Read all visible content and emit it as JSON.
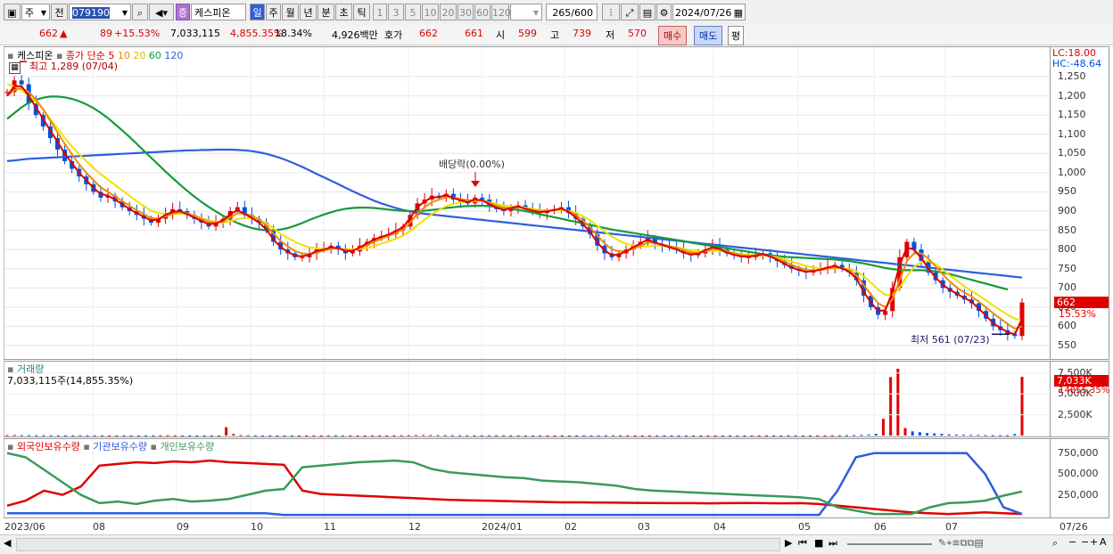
{
  "toolbar": {
    "period_type": "주",
    "prev_label": "전",
    "code": "079190",
    "stock_badge": "증",
    "stock_name": "케스피온",
    "periods": [
      "일",
      "주",
      "월",
      "년",
      "분",
      "초",
      "틱"
    ],
    "intervals": [
      "1",
      "3",
      "5",
      "10",
      "20",
      "30",
      "60",
      "120"
    ],
    "count": "265",
    "count_total": "/600",
    "date": "2024/07/26"
  },
  "quote": {
    "price": "662",
    "arrow": "▲",
    "change": "89",
    "change_pct": "+15.53%",
    "volume": "7,033,115",
    "volume_pct": "4,855.35%",
    "turnover": "18.34%",
    "amount": "4,926백만",
    "bid_label": "호가",
    "ask": "662",
    "bid": "661",
    "open_label": "시",
    "open": "599",
    "high_label": "고",
    "high": "739",
    "low_label": "저",
    "low": "570",
    "buy_label": "매수",
    "sell_label": "매도",
    "eval_label": "평"
  },
  "colors": {
    "up": "#e00000",
    "down": "#0050e0",
    "ma5": "#dd0000",
    "ma10": "#f08c00",
    "ma20": "#f0e000",
    "ma60": "#159a3c",
    "ma120": "#2f5de0",
    "foreign": "#e00000",
    "inst": "#2f5de0",
    "retail": "#3a9a5a"
  },
  "price_panel": {
    "name": "케스피온",
    "legend_label": "종가 단순",
    "ma_periods": [
      "5",
      "10",
      "20",
      "60",
      "120"
    ],
    "high_note": "최고 1,289 (07/04)",
    "low_note": "최저 561 (07/23)",
    "event_note": "배당락(0.00%)",
    "lc": "LC:18.00",
    "hc": "HC:-48.64",
    "current_price": "662",
    "current_pct": "15.53%"
  },
  "volume_panel": {
    "name": "거래량",
    "note": "7,033,115주(14,855.35%)",
    "current": "7,033K",
    "current_pct": "14855.35%"
  },
  "holding_panel": {
    "series_names": [
      "외국인보유수량",
      "기관보유수량",
      "개인보유수량"
    ]
  },
  "x_labels": [
    "2023/06",
    "08",
    "09",
    "10",
    "11",
    "12",
    "2024/01",
    "02",
    "03",
    "04",
    "05",
    "06",
    "07",
    "07/26"
  ],
  "chart_data": [
    {
      "type": "candlestick",
      "title": "케스피온",
      "ylim": [
        550,
        1280
      ],
      "y_ticks": [
        550,
        600,
        650,
        700,
        750,
        800,
        850,
        900,
        950,
        1000,
        1050,
        1100,
        1150,
        1200,
        1250
      ],
      "x_labels": [
        "2023/06",
        "08",
        "09",
        "10",
        "11",
        "12",
        "2024/01",
        "02",
        "03",
        "04",
        "05",
        "06",
        "07"
      ],
      "close": [
        1210,
        1240,
        1230,
        1180,
        1150,
        1120,
        1090,
        1060,
        1030,
        1010,
        990,
        970,
        950,
        935,
        940,
        925,
        910,
        900,
        890,
        880,
        870,
        880,
        895,
        905,
        900,
        890,
        880,
        870,
        860,
        870,
        880,
        900,
        910,
        890,
        880,
        870,
        850,
        820,
        800,
        790,
        780,
        780,
        790,
        800,
        800,
        810,
        800,
        790,
        795,
        810,
        820,
        830,
        835,
        840,
        850,
        860,
        890,
        920,
        930,
        940,
        935,
        945,
        930,
        925,
        920,
        935,
        930,
        915,
        905,
        900,
        910,
        915,
        905,
        900,
        895,
        900,
        905,
        910,
        895,
        880,
        860,
        840,
        810,
        790,
        780,
        790,
        800,
        810,
        820,
        830,
        815,
        810,
        805,
        800,
        790,
        785,
        790,
        800,
        810,
        800,
        790,
        785,
        780,
        780,
        785,
        790,
        780,
        770,
        760,
        750,
        745,
        740,
        745,
        750,
        755,
        760,
        750,
        740,
        720,
        680,
        650,
        630,
        640,
        700,
        780,
        820,
        800,
        770,
        740,
        720,
        700,
        690,
        680,
        670,
        660,
        640,
        620,
        600,
        590,
        580,
        575,
        662
      ],
      "ma5": [
        1200,
        1225,
        1225,
        1200,
        1170,
        1140,
        1110,
        1080,
        1050,
        1025,
        1000,
        980,
        960,
        945,
        940,
        930,
        918,
        905,
        895,
        885,
        876,
        878,
        890,
        898,
        900,
        892,
        883,
        874,
        866,
        868,
        876,
        892,
        902,
        893,
        882,
        870,
        852,
        826,
        806,
        794,
        784,
        782,
        787,
        796,
        800,
        806,
        803,
        796,
        796,
        806,
        816,
        826,
        833,
        839,
        848,
        858,
        882,
        910,
        925,
        936,
        936,
        942,
        934,
        928,
        923,
        930,
        928,
        918,
        909,
        903,
        908,
        912,
        906,
        901,
        897,
        899,
        903,
        907,
        898,
        884,
        866,
        846,
        818,
        798,
        785,
        787,
        796,
        806,
        816,
        826,
        818,
        812,
        806,
        800,
        792,
        787,
        789,
        798,
        806,
        801,
        792,
        786,
        782,
        781,
        784,
        788,
        782,
        773,
        763,
        753,
        747,
        742,
        744,
        748,
        753,
        757,
        751,
        742,
        724,
        690,
        662,
        640,
        642,
        690,
        760,
        805,
        800,
        778,
        750,
        727,
        708,
        695,
        684,
        674,
        664,
        646,
        628,
        608,
        596,
        585,
        579,
        620
      ],
      "ma10": [
        1200,
        1215,
        1220,
        1210,
        1190,
        1165,
        1135,
        1105,
        1075,
        1048,
        1022,
        1000,
        980,
        962,
        950,
        938,
        926,
        914,
        902,
        892,
        882,
        880,
        886,
        893,
        897,
        895,
        888,
        880,
        872,
        870,
        872,
        884,
        894,
        894,
        888,
        878,
        862,
        842,
        822,
        808,
        796,
        790,
        788,
        792,
        797,
        802,
        803,
        800,
        798,
        803,
        811,
        820,
        828,
        835,
        843,
        852,
        870,
        893,
        910,
        923,
        930,
        936,
        935,
        932,
        928,
        929,
        928,
        922,
        914,
        908,
        908,
        910,
        907,
        903,
        900,
        900,
        902,
        905,
        900,
        890,
        876,
        858,
        836,
        816,
        801,
        795,
        796,
        802,
        810,
        818,
        817,
        814,
        809,
        805,
        798,
        792,
        791,
        796,
        802,
        801,
        796,
        790,
        786,
        784,
        784,
        786,
        783,
        777,
        769,
        760,
        753,
        747,
        745,
        746,
        750,
        753,
        752,
        746,
        733,
        708,
        683,
        660,
        650,
        670,
        720,
        770,
        790,
        790,
        776,
        756,
        735,
        716,
        700,
        688,
        678,
        664,
        650,
        634,
        620,
        606,
        594,
        600
      ],
      "ma20": [
        1230,
        1225,
        1215,
        1200,
        1185,
        1165,
        1140,
        1115,
        1090,
        1068,
        1048,
        1030,
        1012,
        996,
        982,
        968,
        954,
        940,
        926,
        913,
        901,
        895,
        892,
        893,
        893,
        892,
        888,
        882,
        876,
        872,
        870,
        874,
        879,
        882,
        882,
        878,
        868,
        855,
        841,
        830,
        820,
        812,
        806,
        803,
        802,
        802,
        802,
        801,
        800,
        801,
        804,
        809,
        815,
        821,
        828,
        836,
        848,
        863,
        878,
        892,
        903,
        913,
        919,
        923,
        925,
        926,
        926,
        923,
        919,
        914,
        912,
        911,
        909,
        906,
        903,
        902,
        902,
        903,
        901,
        896,
        887,
        876,
        862,
        847,
        834,
        823,
        815,
        810,
        808,
        808,
        810,
        810,
        808,
        806,
        802,
        798,
        796,
        796,
        797,
        796,
        794,
        791,
        788,
        786,
        785,
        785,
        783,
        780,
        775,
        769,
        763,
        757,
        753,
        751,
        751,
        752,
        752,
        749,
        743,
        730,
        714,
        696,
        682,
        682,
        702,
        730,
        755,
        768,
        770,
        762,
        748,
        732,
        718,
        704,
        692,
        680,
        668,
        654,
        642,
        630,
        620,
        615
      ],
      "ma60": [
        1140,
        1155,
        1170,
        1182,
        1190,
        1195,
        1198,
        1198,
        1196,
        1192,
        1186,
        1178,
        1168,
        1156,
        1142,
        1126,
        1110,
        1093,
        1075,
        1057,
        1039,
        1021,
        1003,
        986,
        969,
        953,
        938,
        924,
        911,
        899,
        888,
        878,
        869,
        862,
        856,
        852,
        850,
        850,
        852,
        856,
        862,
        869,
        877,
        884,
        891,
        897,
        902,
        906,
        908,
        909,
        909,
        908,
        906,
        904,
        902,
        901,
        900,
        900,
        901,
        903,
        905,
        908,
        910,
        912,
        913,
        914,
        914,
        913,
        911,
        909,
        906,
        903,
        900,
        896,
        892,
        888,
        884,
        880,
        876,
        872,
        868,
        864,
        860,
        856,
        852,
        849,
        846,
        843,
        840,
        837,
        834,
        831,
        828,
        825,
        822,
        818,
        815,
        812,
        809,
        806,
        803,
        800,
        797,
        794,
        791,
        788,
        785,
        783,
        781,
        780,
        779,
        778,
        777,
        776,
        775,
        774,
        772,
        770,
        767,
        764,
        760,
        756,
        752,
        749,
        747,
        746,
        746,
        746,
        745,
        743,
        740,
        736,
        731,
        726,
        721,
        716,
        711,
        706,
        701,
        696
      ],
      "ma120": [
        1030,
        1032,
        1034,
        1036,
        1037,
        1038,
        1039,
        1040,
        1041,
        1042,
        1043,
        1044,
        1045,
        1046,
        1047,
        1048,
        1049,
        1050,
        1051,
        1052,
        1053,
        1054,
        1055,
        1056,
        1057,
        1058,
        1058,
        1059,
        1059,
        1060,
        1060,
        1060,
        1059,
        1058,
        1056,
        1053,
        1049,
        1044,
        1038,
        1031,
        1023,
        1015,
        1006,
        997,
        988,
        979,
        970,
        961,
        952,
        943,
        935,
        927,
        920,
        914,
        908,
        903,
        899,
        896,
        893,
        891,
        889,
        887,
        885,
        883,
        881,
        879,
        877,
        875,
        873,
        871,
        869,
        867,
        865,
        863,
        861,
        859,
        857,
        855,
        853,
        851,
        849,
        847,
        845,
        843,
        841,
        839,
        837,
        835,
        833,
        831,
        829,
        827,
        825,
        823,
        821,
        819,
        817,
        815,
        813,
        811,
        809,
        807,
        805,
        803,
        801,
        799,
        797,
        795,
        793,
        791,
        789,
        787,
        785,
        783,
        781,
        779,
        777,
        775,
        773,
        771,
        769,
        767,
        765,
        763,
        761,
        759,
        757,
        755,
        753,
        751,
        749,
        747,
        745,
        743,
        741,
        739,
        737,
        735,
        733,
        731,
        729,
        727
      ],
      "high": 1289,
      "low": 561
    },
    {
      "type": "bar",
      "title": "거래량",
      "ylim": [
        0,
        8000
      ],
      "y_ticks": [
        2500,
        5000,
        7500
      ],
      "y_tick_labels": [
        "2,500K",
        "5,000K",
        "7,500K"
      ],
      "values": [
        60,
        70,
        50,
        45,
        40,
        42,
        38,
        35,
        30,
        28,
        30,
        26,
        25,
        30,
        28,
        25,
        22,
        20,
        22,
        26,
        24,
        25,
        28,
        30,
        26,
        24,
        22,
        22,
        20,
        22,
        1000,
        180,
        60,
        40,
        30,
        25,
        28,
        24,
        22,
        20,
        22,
        24,
        22,
        20,
        25,
        28,
        24,
        22,
        20,
        22,
        25,
        28,
        30,
        35,
        40,
        50,
        60,
        80,
        70,
        60,
        50,
        45,
        40,
        38,
        36,
        35,
        34,
        30,
        28,
        26,
        25,
        24,
        22,
        22,
        20,
        22,
        24,
        22,
        20,
        22,
        25,
        28,
        35,
        40,
        30,
        25,
        22,
        20,
        22,
        24,
        22,
        20,
        18,
        18,
        20,
        22,
        20,
        18,
        20,
        22,
        20,
        18,
        20,
        22,
        24,
        26,
        28,
        30,
        30,
        25,
        22,
        24,
        26,
        22,
        30,
        40,
        60,
        80,
        120,
        200,
        2000,
        7000,
        8000,
        900,
        500,
        400,
        300,
        250,
        200,
        150,
        120,
        100,
        80,
        80,
        60,
        50,
        45,
        40,
        180,
        7033
      ]
    },
    {
      "type": "line",
      "title": "외국인보유수량 / 기관보유수량 / 개인보유수량",
      "ylim": [
        0,
        800000
      ],
      "y_ticks": [
        250000,
        500000,
        750000
      ],
      "y_tick_labels": [
        "250,000",
        "500,000",
        "750,000"
      ],
      "series": [
        {
          "name": "외국인보유수량",
          "values": [
            120000,
            180000,
            300000,
            250000,
            350000,
            600000,
            620000,
            640000,
            630000,
            650000,
            640000,
            660000,
            640000,
            630000,
            620000,
            610000,
            300000,
            260000,
            250000,
            240000,
            230000,
            220000,
            210000,
            200000,
            190000,
            185000,
            180000,
            175000,
            170000,
            165000,
            160000,
            160000,
            158000,
            156000,
            154000,
            152000,
            150000,
            150000,
            148000,
            150000,
            152000,
            150000,
            148000,
            150000,
            140000,
            120000,
            100000,
            80000,
            60000,
            40000,
            30000,
            20000,
            30000,
            40000,
            30000,
            20000
          ]
        },
        {
          "name": "기관보유수량",
          "values": [
            30000,
            30000,
            30000,
            30000,
            30000,
            30000,
            30000,
            30000,
            30000,
            30000,
            30000,
            30000,
            30000,
            30000,
            30000,
            10000,
            10000,
            10000,
            10000,
            10000,
            10000,
            10000,
            10000,
            10000,
            10000,
            10000,
            10000,
            10000,
            10000,
            10000,
            10000,
            10000,
            10000,
            10000,
            10000,
            10000,
            10000,
            10000,
            10000,
            10000,
            10000,
            10000,
            10000,
            10000,
            10000,
            300000,
            700000,
            750000,
            750000,
            750000,
            750000,
            750000,
            750000,
            500000,
            100000,
            20000
          ]
        },
        {
          "name": "개인보유수량",
          "values": [
            750000,
            700000,
            550000,
            400000,
            250000,
            150000,
            170000,
            140000,
            180000,
            200000,
            170000,
            180000,
            200000,
            250000,
            300000,
            320000,
            580000,
            600000,
            620000,
            640000,
            650000,
            660000,
            640000,
            560000,
            520000,
            500000,
            480000,
            460000,
            450000,
            420000,
            410000,
            400000,
            380000,
            360000,
            320000,
            300000,
            290000,
            280000,
            270000,
            260000,
            250000,
            240000,
            230000,
            220000,
            200000,
            100000,
            60000,
            20000,
            20000,
            20000,
            100000,
            150000,
            160000,
            180000,
            240000,
            290000
          ]
        }
      ]
    }
  ]
}
